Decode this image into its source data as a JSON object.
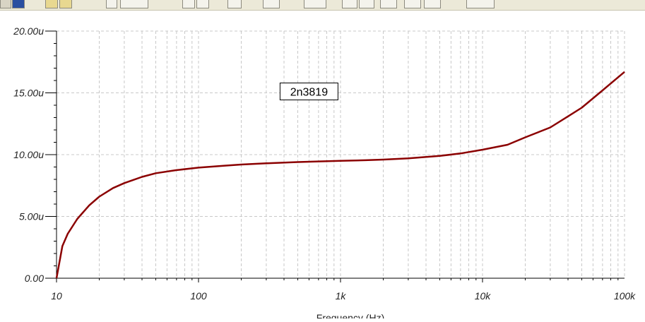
{
  "chart_data": {
    "type": "line",
    "title": "",
    "xlabel": "Frequency (Hz)",
    "ylabel": "",
    "x_scale": "log",
    "xlim": [
      10,
      100000
    ],
    "ylim": [
      0,
      2e-05
    ],
    "grid": true,
    "x_ticks": [
      {
        "value": 10,
        "label": "10"
      },
      {
        "value": 100,
        "label": "100"
      },
      {
        "value": 1000,
        "label": "1k"
      },
      {
        "value": 10000,
        "label": "10k"
      },
      {
        "value": 100000,
        "label": "100k"
      }
    ],
    "y_ticks": [
      {
        "value": 0,
        "label": "0.00"
      },
      {
        "value": 5e-06,
        "label": "5.00u"
      },
      {
        "value": 1e-05,
        "label": "10.00u"
      },
      {
        "value": 1.5e-05,
        "label": "15.00u"
      },
      {
        "value": 2e-05,
        "label": "20.00u"
      }
    ],
    "series": [
      {
        "name": "2n3819",
        "color": "#8b0000",
        "points": [
          [
            10,
            0.0
          ],
          [
            11,
            2.6e-06
          ],
          [
            12,
            3.6e-06
          ],
          [
            14,
            4.8e-06
          ],
          [
            17,
            5.9e-06
          ],
          [
            20,
            6.6e-06
          ],
          [
            25,
            7.3e-06
          ],
          [
            30,
            7.7e-06
          ],
          [
            40,
            8.2e-06
          ],
          [
            50,
            8.5e-06
          ],
          [
            70,
            8.75e-06
          ],
          [
            100,
            8.95e-06
          ],
          [
            150,
            9.1e-06
          ],
          [
            200,
            9.2e-06
          ],
          [
            300,
            9.3e-06
          ],
          [
            500,
            9.4e-06
          ],
          [
            700,
            9.45e-06
          ],
          [
            1000,
            9.5e-06
          ],
          [
            1500,
            9.55e-06
          ],
          [
            2000,
            9.6e-06
          ],
          [
            3000,
            9.7e-06
          ],
          [
            5000,
            9.9e-06
          ],
          [
            7000,
            1.01e-05
          ],
          [
            10000,
            1.04e-05
          ],
          [
            15000,
            1.08e-05
          ],
          [
            20000,
            1.14e-05
          ],
          [
            30000,
            1.22e-05
          ],
          [
            40000,
            1.31e-05
          ],
          [
            50000,
            1.38e-05
          ],
          [
            70000,
            1.52e-05
          ],
          [
            100000,
            1.67e-05
          ]
        ]
      }
    ],
    "annotations": [
      {
        "text": "2n3819",
        "x": 600,
        "y": 1.5e-05
      }
    ]
  },
  "toolbar": {
    "icons": [
      "save-icon",
      "copy-icon",
      "paste-icon",
      "cursor-icon",
      "zoom-icon",
      "minus-icon",
      "axis-icon",
      "help-icon",
      "list-icon",
      "circle-icon",
      "marker-icon",
      "marker-icon",
      "link-icon",
      "pen-icon",
      "line-icon",
      "dropdown-icon"
    ]
  }
}
